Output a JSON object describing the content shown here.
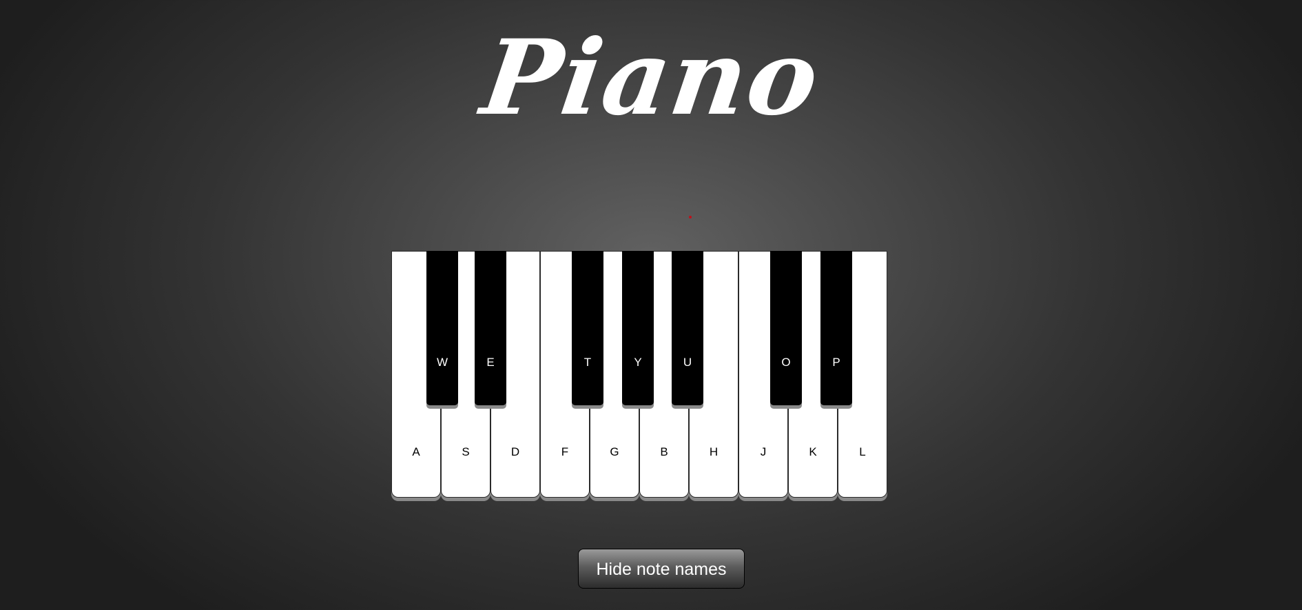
{
  "title": "Piano",
  "white_keys": [
    "A",
    "S",
    "D",
    "F",
    "G",
    "B",
    "H",
    "J",
    "K",
    "L"
  ],
  "black_keys": [
    "W",
    "E",
    "T",
    "Y",
    "U",
    "O",
    "P"
  ],
  "toggle_button_label": "Hide note names",
  "colors": {
    "background": "#3c3c3c",
    "white_key": "#ffffff",
    "black_key": "#000000",
    "accent_dot": "#c0101a"
  }
}
